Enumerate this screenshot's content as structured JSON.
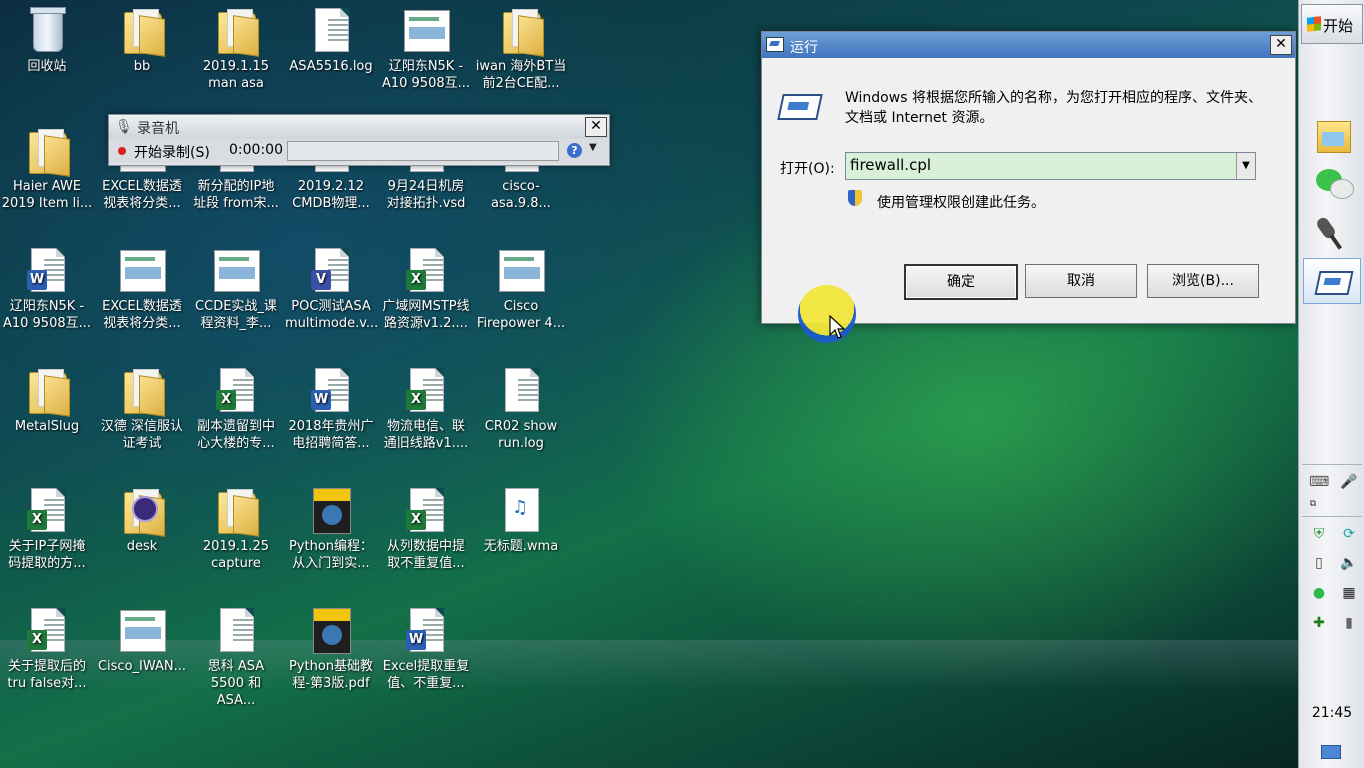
{
  "desktop_icons": [
    {
      "label": "回收站",
      "type": "recycle"
    },
    {
      "label": "bb",
      "type": "folder"
    },
    {
      "label": "2019.1.15\nman asa",
      "type": "folder"
    },
    {
      "label": "ASA5516.log",
      "type": "doc"
    },
    {
      "label": "辽阳东N5K -\nA10 9508互...",
      "type": "thumb"
    },
    {
      "label": "iwan 海外BT当\n前2台CE配...",
      "type": "folder"
    },
    {
      "label": "Haier AWE\n2019 Item li...",
      "type": "folder"
    },
    {
      "label": "EXCEL数据透\n视表将分类...",
      "type": "thumb"
    },
    {
      "label": "新分配的IP地\n址段 from宋...",
      "type": "doc"
    },
    {
      "label": "2019.2.12\nCMDB物理...",
      "type": "doc"
    },
    {
      "label": "9月24日机房\n对接拓扑.vsd",
      "type": "doc"
    },
    {
      "label": "cisco-asa.9.8...",
      "type": "doc"
    },
    {
      "label": "辽阳东N5K -\nA10 9508互...",
      "type": "word"
    },
    {
      "label": "EXCEL数据透\n视表将分类...",
      "type": "thumb"
    },
    {
      "label": "CCDE实战_课\n程资料_李...",
      "type": "thumb"
    },
    {
      "label": "POC测试ASA\nmultimode.v...",
      "type": "visio"
    },
    {
      "label": "广域网MSTP线\n路资源v1.2....",
      "type": "excel"
    },
    {
      "label": "Cisco\nFirepower 4...",
      "type": "thumb"
    },
    {
      "label": "MetalSlug",
      "type": "folder"
    },
    {
      "label": "汉德 深信服认\n证考试",
      "type": "folder"
    },
    {
      "label": "副本遗留到中\n心大楼的专...",
      "type": "excel"
    },
    {
      "label": "2018年贵州广\n电招聘简答...",
      "type": "word"
    },
    {
      "label": "物流电信、联\n通旧线路v1....",
      "type": "excel"
    },
    {
      "label": "CR02 show\nrun.log",
      "type": "doc"
    },
    {
      "label": "关于IP子网掩\n码提取的方...",
      "type": "excel"
    },
    {
      "label": "desk",
      "type": "eclipse"
    },
    {
      "label": "2019.1.25\ncapture",
      "type": "folder"
    },
    {
      "label": "Python编程：\n从入门到实...",
      "type": "book"
    },
    {
      "label": "从列数据中提\n取不重复值...",
      "type": "excel"
    },
    {
      "label": "无标题.wma",
      "type": "media"
    },
    {
      "label": "关于提取后的\ntru false对...",
      "type": "excel"
    },
    {
      "label": "Cisco_IWAN...",
      "type": "thumb"
    },
    {
      "label": "思科 ASA\n5500 和 ASA...",
      "type": "doc"
    },
    {
      "label": "Python基础教\n程-第3版.pdf",
      "type": "book"
    },
    {
      "label": "Excel提取重复\n值、不重复...",
      "type": "word"
    }
  ],
  "recorder": {
    "title": "录音机",
    "record_label": "开始录制(S)",
    "time": "0:00:00",
    "close": "✕",
    "help": "?",
    "help_dropdown": "▼"
  },
  "run_dialog": {
    "title": "运行",
    "close": "✕",
    "description": "Windows 将根据您所输入的名称，为您打开相应的程序、文件夹、文档或 Internet 资源。",
    "open_label": "打开(O):",
    "input_value": "firewall.cpl",
    "dropdown_glyph": "▼",
    "admin_text": "使用管理权限创建此任务。",
    "ok_label": "确定",
    "cancel_label": "取消",
    "browse_label": "浏览(B)..."
  },
  "taskbar": {
    "start_label": "开始",
    "clock": "21:45",
    "items": [
      "file-explorer",
      "wechat",
      "sound-recorder",
      "run"
    ]
  }
}
